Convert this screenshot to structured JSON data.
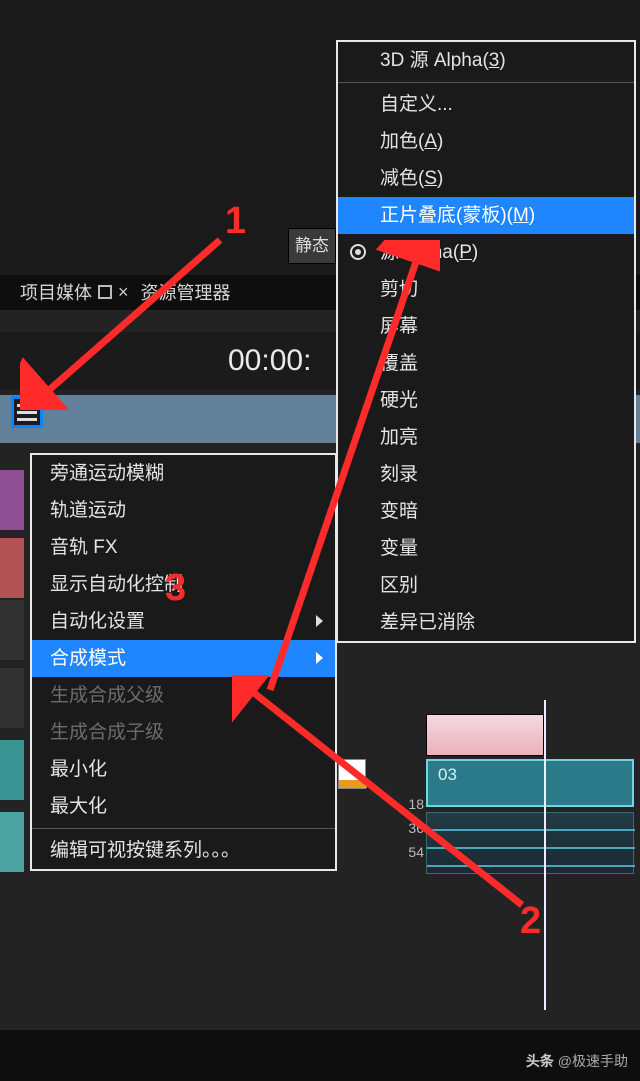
{
  "header": {
    "static_label": "静态"
  },
  "tabs": {
    "project_media": "项目媒体",
    "explorer": "资源管理器"
  },
  "timecode": "00:00:",
  "primary_menu": {
    "bypass_motion_blur": "旁通运动模糊",
    "track_motion": "轨道运动",
    "audio_fx": "音轨 FX",
    "show_automation": "显示自动化控制",
    "automation_settings": "自动化设置",
    "compositing_mode": "合成模式",
    "make_parent": "生成合成父级",
    "make_child": "生成合成子级",
    "minimize": "最小化",
    "maximize": "最大化",
    "edit_visible_buttons": "编辑可视按键系列。。。"
  },
  "sub_menu": {
    "source_alpha_3d": "3D 源 Alpha(",
    "source_alpha_3d_hk": "3",
    "source_alpha_3d_tail": ")",
    "custom": "自定义...",
    "add": "加色(",
    "add_hk": "A",
    "add_tail": ")",
    "subtract": "减色(",
    "subtract_hk": "S",
    "subtract_tail": ")",
    "multiply_mask": "正片叠底(蒙板)(",
    "multiply_mask_hk": "M",
    "multiply_mask_tail": ")",
    "source_alpha": "源 Alpha(",
    "source_alpha_hk": "P",
    "source_alpha_tail": ")",
    "cut": "剪切",
    "screen": "屏幕",
    "overlay": "覆盖",
    "hard_light": "硬光",
    "dodge": "加亮",
    "burn": "刻录",
    "darken": "变暗",
    "lighten": "变量",
    "difference": "区别",
    "diff_squared": "差异已消除"
  },
  "clips": {
    "blue_label": "03"
  },
  "ticks": {
    "t1": "18",
    "t2": "36",
    "t3": "54"
  },
  "callouts": {
    "c1": "1",
    "c2": "2",
    "c3": "3"
  },
  "watermark": {
    "prefix": "头条",
    "suffix": "@极速手助"
  }
}
